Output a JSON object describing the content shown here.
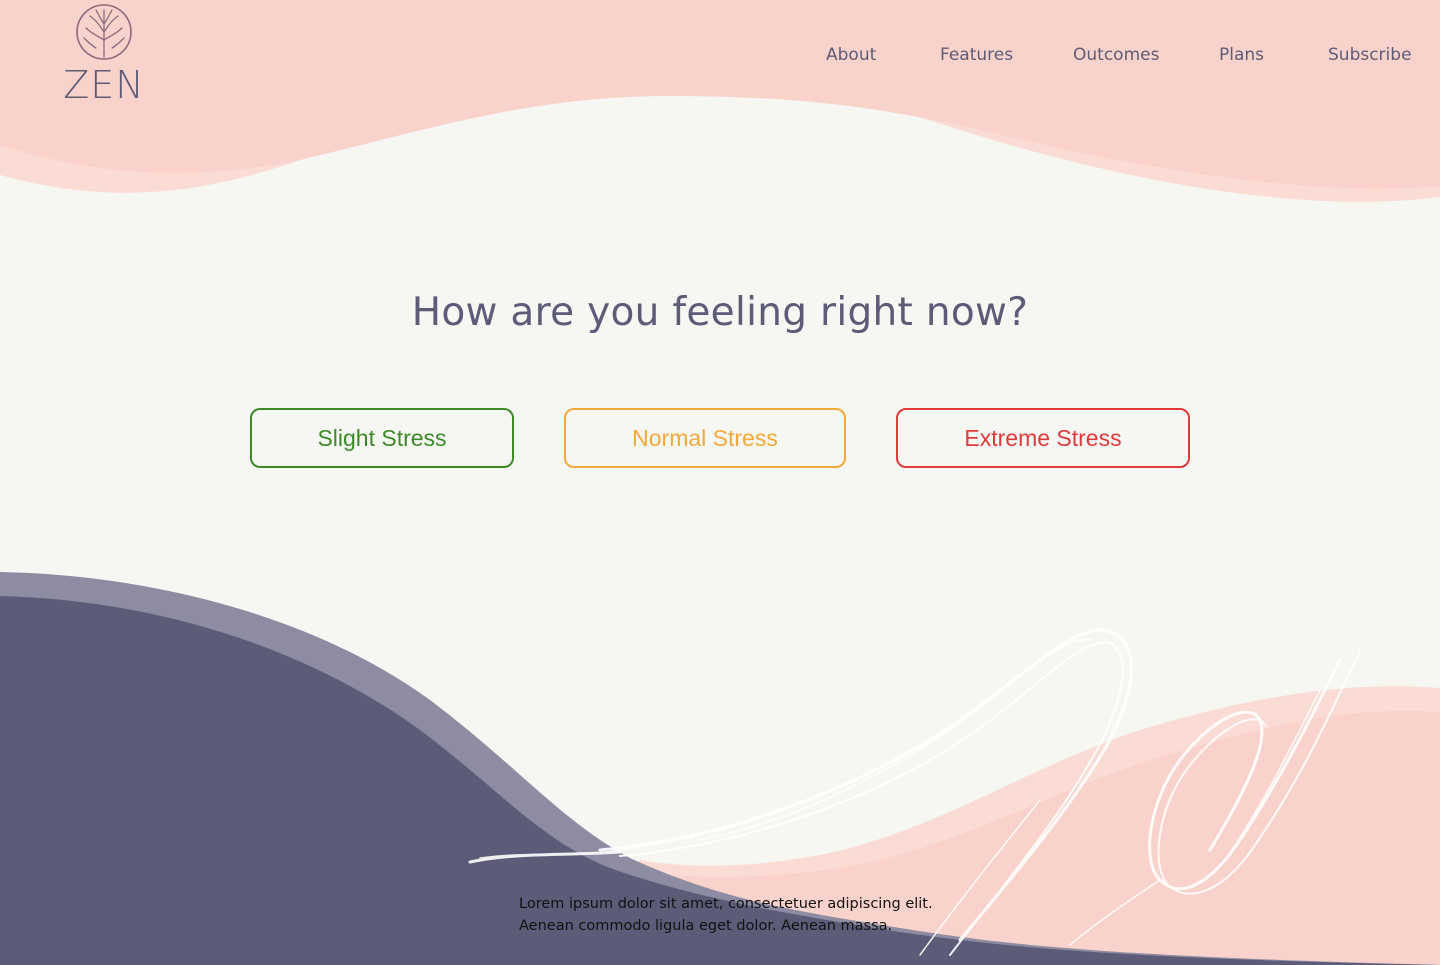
{
  "brand": {
    "name": "ZEN",
    "logo_icon": "tree-icon"
  },
  "nav": {
    "items": [
      {
        "label": "About"
      },
      {
        "label": "Features"
      },
      {
        "label": "Outcomes"
      },
      {
        "label": "Plans"
      },
      {
        "label": "Subscribe"
      }
    ]
  },
  "main": {
    "question": "How are you feeling right now?",
    "options": [
      {
        "label": "Slight Stress",
        "color": "#3E8A2A"
      },
      {
        "label": "Normal Stress",
        "color": "#F2A93B"
      },
      {
        "label": "Extreme Stress",
        "color": "#E03A3A"
      }
    ]
  },
  "footer": {
    "line1": "Lorem ipsum dolor sit amet, consectetuer adipiscing elit.",
    "line2": "Aenean commodo ligula eget dolor. Aenean massa."
  },
  "colors": {
    "background": "#F6F6F3",
    "pink": "#F9D3CB",
    "pink_light": "#FADFD8",
    "navy": "#5D5C78",
    "navy_light": "#8E8CA2"
  }
}
